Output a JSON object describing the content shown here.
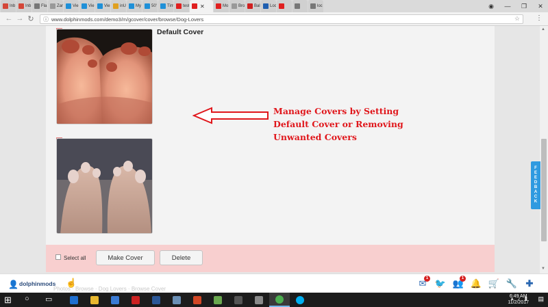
{
  "browser": {
    "tabs": [
      {
        "label": "Inb",
        "favicon_color": "#d44638"
      },
      {
        "label": "Inb",
        "favicon_color": "#d44638"
      },
      {
        "label": "Fla",
        "favicon_color": "#777777"
      },
      {
        "label": "Zar",
        "favicon_color": "#999999"
      },
      {
        "label": "Vie",
        "favicon_color": "#1f90d8"
      },
      {
        "label": "Vie",
        "favicon_color": "#1f90d8"
      },
      {
        "label": "Vie",
        "favicon_color": "#1f90d8"
      },
      {
        "label": "inU",
        "favicon_color": "#e0a020"
      },
      {
        "label": "My",
        "favicon_color": "#1f90d8"
      },
      {
        "label": "50'",
        "favicon_color": "#1f90d8"
      },
      {
        "label": "Tim",
        "favicon_color": "#1f90d8"
      },
      {
        "label": "test",
        "favicon_color": "#e02020"
      },
      {
        "label": "",
        "favicon_color": "#e02020",
        "active": true
      },
      {
        "label": "Mo",
        "favicon_color": "#e02020"
      },
      {
        "label": "Bro",
        "favicon_color": "#999999"
      },
      {
        "label": "Bal",
        "favicon_color": "#d02020"
      },
      {
        "label": "Loc",
        "favicon_color": "#1f5fb0"
      },
      {
        "label": "",
        "favicon_color": "#e02020"
      },
      {
        "label": "",
        "favicon_color": "#777777"
      },
      {
        "label": "loc",
        "favicon_color": "#777777"
      }
    ],
    "url": "www.dolphinmods.com/demo3/m/gcover/cover/browse/Dog-Lovers"
  },
  "page": {
    "default_cover_label": "Default Cover",
    "annotation": {
      "line1": "Manage Covers by Setting",
      "line2": "Default Cover or Removing",
      "line3": "Unwanted Covers"
    },
    "select_all_label": "Select all",
    "make_cover_label": "Make Cover",
    "delete_label": "Delete",
    "feedback_letters": [
      "F",
      "E",
      "E",
      "D",
      "B",
      "A",
      "C",
      "K"
    ]
  },
  "site_bar": {
    "brand": "dolphinmods",
    "faded_crumbs": "Photos   ·   Browse   ·   Dog Lovers   ·   Browse Cover",
    "badges": {
      "mail": "1",
      "friends": "1"
    }
  },
  "taskbar": {
    "time": "6:49 AM",
    "date": "11/2/2017"
  },
  "colors": {
    "annotation_red": "#e0161b",
    "action_bar": "#f8cfcf",
    "brand_blue": "#2a67b1"
  }
}
